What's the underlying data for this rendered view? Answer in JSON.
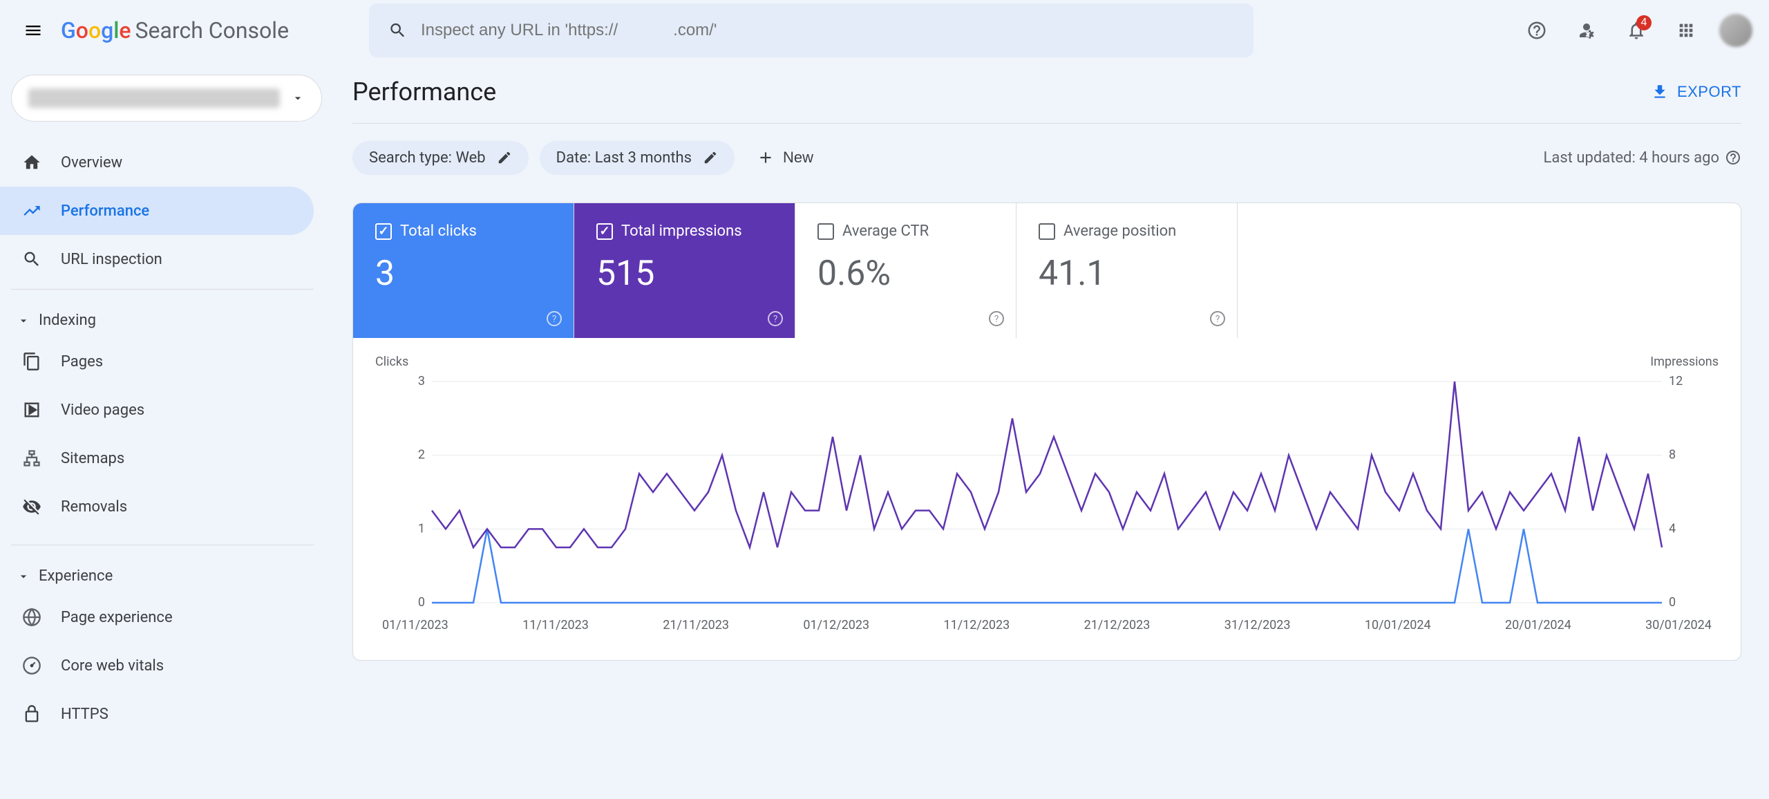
{
  "app_name_suffix": "Search Console",
  "search": {
    "placeholder": "Inspect any URL in 'https://            .com/'"
  },
  "notifications": {
    "count": "4"
  },
  "sidebar": {
    "items": [
      {
        "label": "Overview",
        "icon": "home-icon"
      },
      {
        "label": "Performance",
        "icon": "trending-icon"
      },
      {
        "label": "URL inspection",
        "icon": "search-icon"
      }
    ],
    "sections": [
      {
        "title": "Indexing",
        "items": [
          {
            "label": "Pages",
            "icon": "pages-icon"
          },
          {
            "label": "Video pages",
            "icon": "video-icon"
          },
          {
            "label": "Sitemaps",
            "icon": "sitemap-icon"
          },
          {
            "label": "Removals",
            "icon": "eye-off-icon"
          }
        ]
      },
      {
        "title": "Experience",
        "items": [
          {
            "label": "Page experience",
            "icon": "globe-icon"
          },
          {
            "label": "Core web vitals",
            "icon": "gauge-icon"
          },
          {
            "label": "HTTPS",
            "icon": "lock-icon"
          }
        ]
      }
    ]
  },
  "page": {
    "title": "Performance",
    "export": "EXPORT",
    "filters": {
      "search_type": "Search type: Web",
      "date": "Date: Last 3 months",
      "new": "New"
    },
    "updated": "Last updated: 4 hours ago"
  },
  "metrics": [
    {
      "label": "Total clicks",
      "value": "3",
      "checked": true,
      "color": "blue"
    },
    {
      "label": "Total impressions",
      "value": "515",
      "checked": true,
      "color": "purple"
    },
    {
      "label": "Average CTR",
      "value": "0.6%",
      "checked": false,
      "color": "white"
    },
    {
      "label": "Average position",
      "value": "41.1",
      "checked": false,
      "color": "white"
    }
  ],
  "chart_data": {
    "type": "line",
    "xlabel_left": "Clicks",
    "xlabel_right": "Impressions",
    "left_axis": {
      "label": "Clicks",
      "ticks": [
        0,
        1,
        2,
        3
      ],
      "ylim": [
        0,
        3
      ]
    },
    "right_axis": {
      "label": "Impressions",
      "ticks": [
        0,
        4,
        8,
        12
      ],
      "ylim": [
        0,
        12
      ]
    },
    "x_categories": [
      "01/11/2023",
      "11/11/2023",
      "21/11/2023",
      "01/12/2023",
      "11/12/2023",
      "21/12/2023",
      "31/12/2023",
      "10/01/2024",
      "20/01/2024",
      "30/01/2024"
    ],
    "series": [
      {
        "name": "Clicks",
        "color": "#4285f4",
        "axis": "left",
        "values": [
          0,
          0,
          0,
          0,
          1,
          0,
          0,
          0,
          0,
          0,
          0,
          0,
          0,
          0,
          0,
          0,
          0,
          0,
          0,
          0,
          0,
          0,
          0,
          0,
          0,
          0,
          0,
          0,
          0,
          0,
          0,
          0,
          0,
          0,
          0,
          0,
          0,
          0,
          0,
          0,
          0,
          0,
          0,
          0,
          0,
          0,
          0,
          0,
          0,
          0,
          0,
          0,
          0,
          0,
          0,
          0,
          0,
          0,
          0,
          0,
          0,
          0,
          0,
          0,
          0,
          0,
          0,
          0,
          0,
          0,
          0,
          0,
          0,
          0,
          0,
          1,
          0,
          0,
          0,
          1,
          0,
          0,
          0,
          0,
          0,
          0,
          0,
          0,
          0,
          0
        ]
      },
      {
        "name": "Impressions",
        "color": "#5e35b1",
        "axis": "right",
        "values": [
          5,
          4,
          5,
          3,
          4,
          3,
          3,
          4,
          4,
          3,
          3,
          4,
          3,
          3,
          4,
          7,
          6,
          7,
          6,
          5,
          6,
          8,
          5,
          3,
          6,
          3,
          6,
          5,
          5,
          9,
          5,
          8,
          4,
          6,
          4,
          5,
          5,
          4,
          7,
          6,
          4,
          6,
          10,
          6,
          7,
          9,
          7,
          5,
          7,
          6,
          4,
          6,
          5,
          7,
          4,
          5,
          6,
          4,
          6,
          5,
          7,
          5,
          8,
          6,
          4,
          6,
          5,
          4,
          8,
          6,
          5,
          7,
          5,
          4,
          12,
          5,
          6,
          4,
          6,
          5,
          6,
          7,
          5,
          9,
          5,
          8,
          6,
          4,
          7,
          3
        ]
      }
    ]
  }
}
